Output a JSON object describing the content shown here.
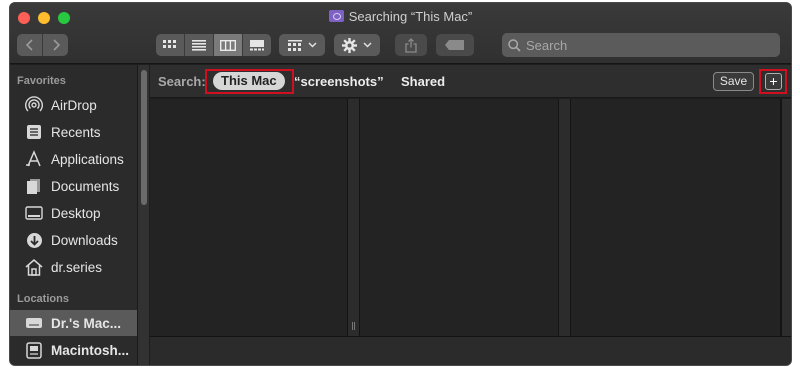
{
  "window": {
    "title": "Searching “This Mac”"
  },
  "toolbar": {
    "search_placeholder": "Search"
  },
  "sidebar": {
    "favorites_header": "Favorites",
    "favorites": [
      {
        "label": "AirDrop",
        "icon": "airdrop-icon"
      },
      {
        "label": "Recents",
        "icon": "recents-icon"
      },
      {
        "label": "Applications",
        "icon": "applications-icon"
      },
      {
        "label": "Documents",
        "icon": "documents-icon"
      },
      {
        "label": "Desktop",
        "icon": "desktop-icon"
      },
      {
        "label": "Downloads",
        "icon": "downloads-icon"
      },
      {
        "label": "dr.series",
        "icon": "home-icon"
      }
    ],
    "locations_header": "Locations",
    "locations": [
      {
        "label": "Dr.'s Mac...",
        "icon": "computer-icon",
        "selected": true
      },
      {
        "label": "Macintosh...",
        "icon": "disk-icon"
      }
    ]
  },
  "scope": {
    "label": "Search:",
    "options": [
      "This Mac",
      "“screenshots”",
      "Shared"
    ],
    "selected": "This Mac",
    "save_label": "Save",
    "add_label": "+"
  },
  "colors": {
    "highlight_box": "#d01020",
    "window_bg": "#1e1e1e"
  }
}
